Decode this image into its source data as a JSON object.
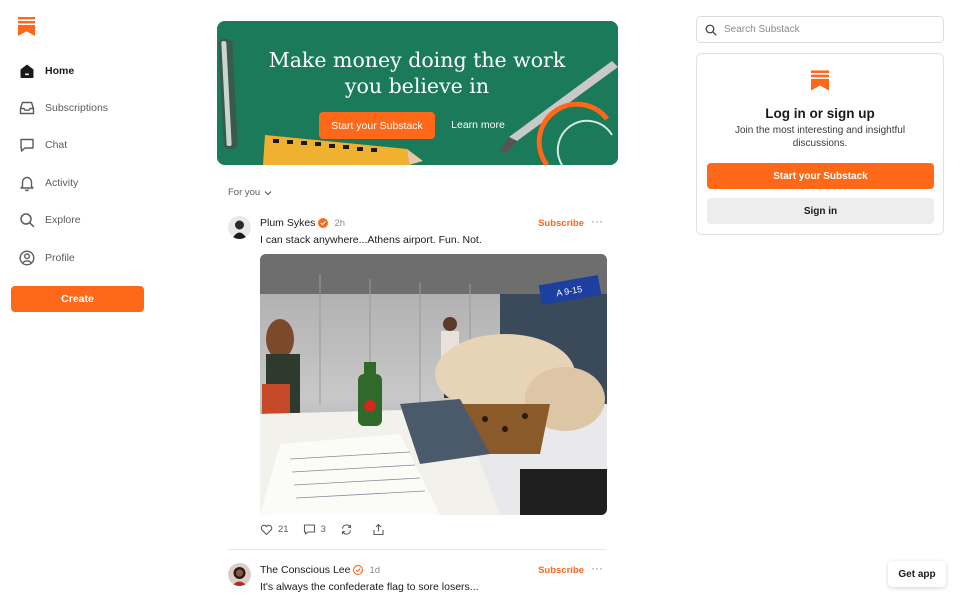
{
  "brand": {
    "logo_icon": "substack-bookmark-icon",
    "accent_color": "#ff6719"
  },
  "sidebar": {
    "items": [
      {
        "label": "Home",
        "icon": "home-icon",
        "active": true
      },
      {
        "label": "Subscriptions",
        "icon": "inbox-icon",
        "active": false
      },
      {
        "label": "Chat",
        "icon": "chat-bubble-icon",
        "active": false
      },
      {
        "label": "Activity",
        "icon": "bell-icon",
        "active": false
      },
      {
        "label": "Explore",
        "icon": "search-icon",
        "active": false
      },
      {
        "label": "Profile",
        "icon": "profile-icon",
        "active": false
      }
    ],
    "create_label": "Create"
  },
  "banner": {
    "title": "Make money doing the work you believe in",
    "cta_label": "Start your Substack",
    "learn_more_label": "Learn more",
    "background_color": "#1a7a5a"
  },
  "feed": {
    "filter_label": "For you",
    "posts": [
      {
        "author": "Plum Sykes",
        "verified": true,
        "time": "2h",
        "subscribe_label": "Subscribe",
        "more_label": "···",
        "text": "I can stack anywhere...Athens airport. Fun. Not.",
        "likes": "21",
        "comments": "3"
      },
      {
        "author": "The Conscious Lee",
        "verified": true,
        "time": "1d",
        "subscribe_label": "Subscribe",
        "more_label": "···",
        "text": "It's always the confederate flag to sore losers..."
      }
    ]
  },
  "search": {
    "placeholder": "Search Substack",
    "value": ""
  },
  "login_card": {
    "title": "Log in or sign up",
    "subtitle": "Join the most interesting and insightful discussions.",
    "primary_label": "Start your Substack",
    "secondary_label": "Sign in"
  },
  "get_app_label": "Get app"
}
